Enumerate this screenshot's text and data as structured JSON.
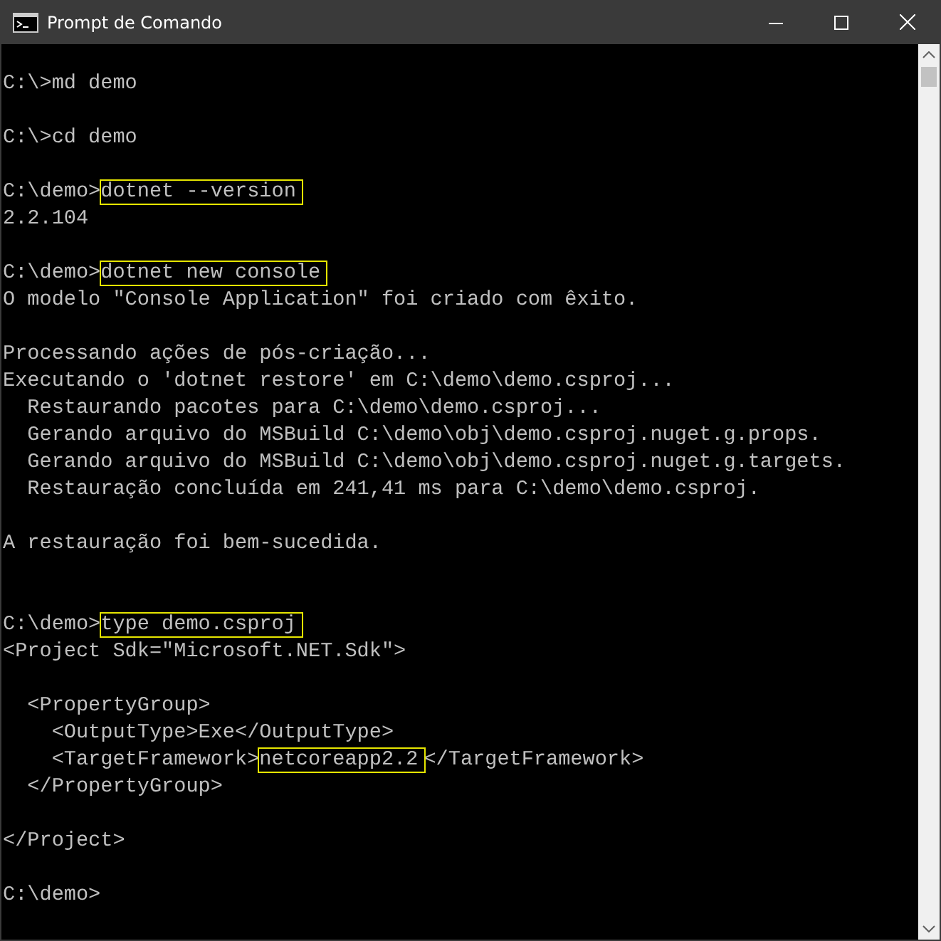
{
  "window": {
    "title": "Prompt de Comando"
  },
  "console": {
    "lines": [
      {
        "kind": "blank"
      },
      {
        "kind": "text",
        "segments": [
          {
            "text": "C:\\>md demo",
            "boxed": false
          }
        ]
      },
      {
        "kind": "blank"
      },
      {
        "kind": "text",
        "segments": [
          {
            "text": "C:\\>cd demo",
            "boxed": false
          }
        ]
      },
      {
        "kind": "blank"
      },
      {
        "kind": "text",
        "segments": [
          {
            "text": "C:\\demo>",
            "boxed": false
          },
          {
            "text": "dotnet --version",
            "boxed": true
          }
        ]
      },
      {
        "kind": "text",
        "segments": [
          {
            "text": "2.2.104",
            "boxed": false
          }
        ]
      },
      {
        "kind": "blank"
      },
      {
        "kind": "text",
        "segments": [
          {
            "text": "C:\\demo>",
            "boxed": false
          },
          {
            "text": "dotnet new console",
            "boxed": true
          }
        ]
      },
      {
        "kind": "text",
        "segments": [
          {
            "text": "O modelo \"Console Application\" foi criado com êxito.",
            "boxed": false
          }
        ]
      },
      {
        "kind": "blank"
      },
      {
        "kind": "text",
        "segments": [
          {
            "text": "Processando ações de pós-criação...",
            "boxed": false
          }
        ]
      },
      {
        "kind": "text",
        "segments": [
          {
            "text": "Executando o 'dotnet restore' em C:\\demo\\demo.csproj...",
            "boxed": false
          }
        ]
      },
      {
        "kind": "text",
        "segments": [
          {
            "text": "  Restaurando pacotes para C:\\demo\\demo.csproj...",
            "boxed": false
          }
        ]
      },
      {
        "kind": "text",
        "segments": [
          {
            "text": "  Gerando arquivo do MSBuild C:\\demo\\obj\\demo.csproj.nuget.g.props.",
            "boxed": false
          }
        ]
      },
      {
        "kind": "text",
        "segments": [
          {
            "text": "  Gerando arquivo do MSBuild C:\\demo\\obj\\demo.csproj.nuget.g.targets.",
            "boxed": false
          }
        ]
      },
      {
        "kind": "text",
        "segments": [
          {
            "text": "  Restauração concluída em 241,41 ms para C:\\demo\\demo.csproj.",
            "boxed": false
          }
        ]
      },
      {
        "kind": "blank"
      },
      {
        "kind": "text",
        "segments": [
          {
            "text": "A restauração foi bem-sucedida.",
            "boxed": false
          }
        ]
      },
      {
        "kind": "blank"
      },
      {
        "kind": "blank"
      },
      {
        "kind": "text",
        "segments": [
          {
            "text": "C:\\demo>",
            "boxed": false
          },
          {
            "text": "type demo.csproj",
            "boxed": true
          }
        ]
      },
      {
        "kind": "text",
        "segments": [
          {
            "text": "<Project Sdk=\"Microsoft.NET.Sdk\">",
            "boxed": false
          }
        ]
      },
      {
        "kind": "blank"
      },
      {
        "kind": "text",
        "segments": [
          {
            "text": "  <PropertyGroup>",
            "boxed": false
          }
        ]
      },
      {
        "kind": "text",
        "segments": [
          {
            "text": "    <OutputType>Exe</OutputType>",
            "boxed": false
          }
        ]
      },
      {
        "kind": "text",
        "segments": [
          {
            "text": "    <TargetFramework>",
            "boxed": false
          },
          {
            "text": "netcoreapp2.2",
            "boxed": true
          },
          {
            "text": "</TargetFramework>",
            "boxed": false
          }
        ]
      },
      {
        "kind": "text",
        "segments": [
          {
            "text": "  </PropertyGroup>",
            "boxed": false
          }
        ]
      },
      {
        "kind": "blank"
      },
      {
        "kind": "text",
        "segments": [
          {
            "text": "</Project>",
            "boxed": false
          }
        ]
      },
      {
        "kind": "blank"
      },
      {
        "kind": "text",
        "segments": [
          {
            "text": "C:\\demo>",
            "boxed": false
          }
        ]
      }
    ]
  }
}
